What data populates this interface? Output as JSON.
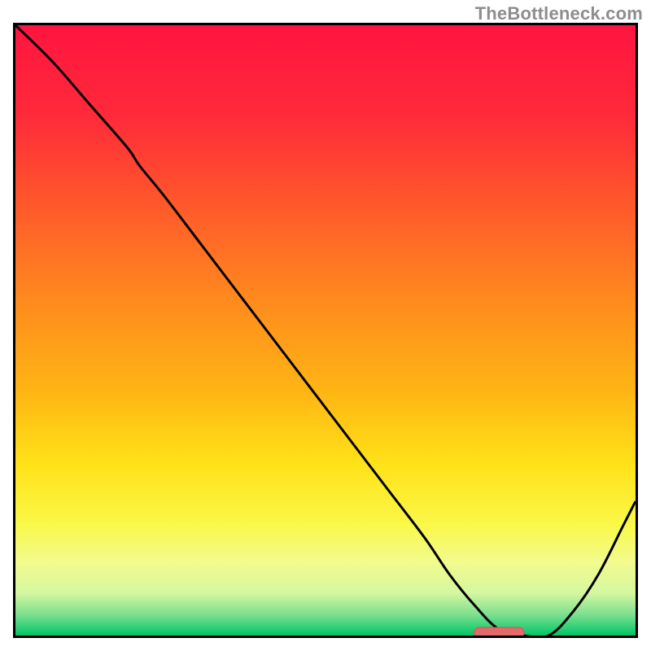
{
  "watermark": "TheBottleneck.com",
  "colors": {
    "gradient_stops": [
      {
        "offset": 0.0,
        "color": "#ff153f"
      },
      {
        "offset": 0.15,
        "color": "#ff2a3a"
      },
      {
        "offset": 0.3,
        "color": "#ff5a2a"
      },
      {
        "offset": 0.45,
        "color": "#ff8a1e"
      },
      {
        "offset": 0.6,
        "color": "#ffb514"
      },
      {
        "offset": 0.72,
        "color": "#ffe218"
      },
      {
        "offset": 0.82,
        "color": "#faf84a"
      },
      {
        "offset": 0.88,
        "color": "#f2fb8e"
      },
      {
        "offset": 0.93,
        "color": "#d6f7a0"
      },
      {
        "offset": 0.965,
        "color": "#7fe090"
      },
      {
        "offset": 1.0,
        "color": "#00c566"
      }
    ],
    "curve": "#000000",
    "marker_fill": "#e46a6a",
    "marker_stroke": "#d65c5c"
  },
  "chart_data": {
    "type": "line",
    "title": "",
    "xlabel": "",
    "ylabel": "",
    "xlim": [
      0,
      100
    ],
    "ylim": [
      0,
      100
    ],
    "series": [
      {
        "name": "bottleneck-curve",
        "x": [
          0,
          6,
          12,
          18,
          20,
          24,
          30,
          36,
          42,
          48,
          54,
          60,
          66,
          70,
          74,
          78,
          82,
          86,
          90,
          94,
          98,
          100
        ],
        "y": [
          100,
          94,
          87,
          80,
          77,
          72,
          64,
          56,
          48,
          40,
          32,
          24,
          16,
          10,
          5,
          1,
          0,
          0,
          4,
          10,
          18,
          22
        ]
      }
    ],
    "marker": {
      "x_start": 74,
      "x_end": 82,
      "y": 0.5,
      "label": "optimal-range"
    }
  }
}
